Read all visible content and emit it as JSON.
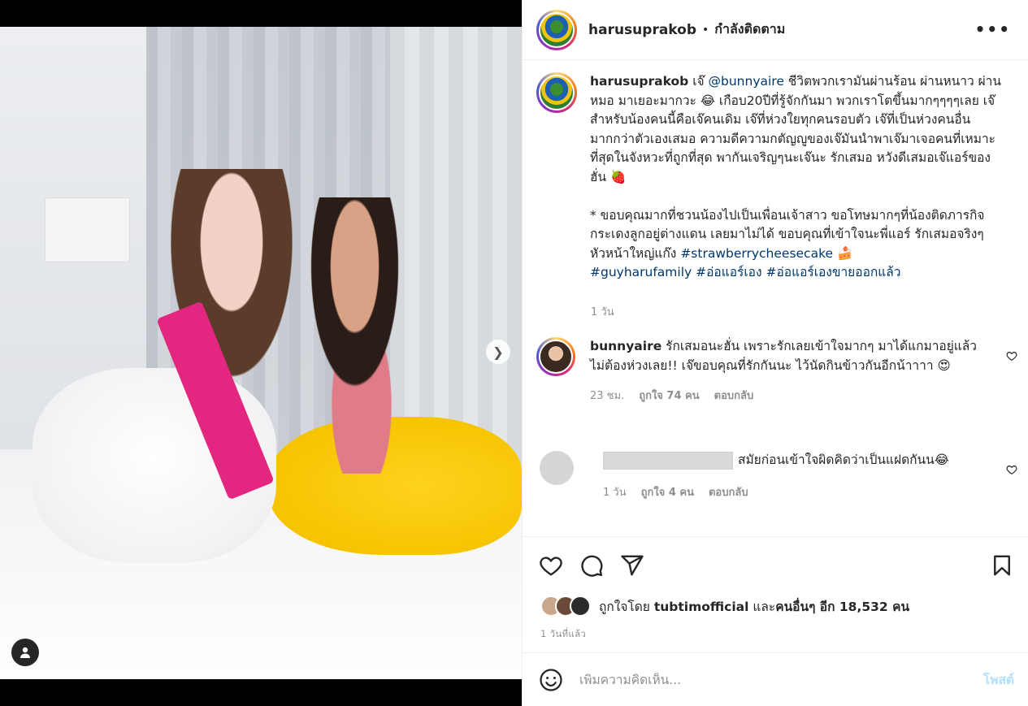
{
  "post": {
    "username": "harusuprakob",
    "separator": "•",
    "follow_status": "กำลังติดตาม",
    "more": "•••",
    "image_alt": "",
    "carousel_next": "❯"
  },
  "caption": {
    "username": "harusuprakob",
    "text_1": " เจ๊ ",
    "mention": "@bunnyaire",
    "text_2": " ชีวิตพวกเรามันผ่านร้อน ผ่านหนาว ผ่านหมอ มาเยอะมากวะ 😂 เกือบ20ปีที่รู้จักกันมา พวกเราโตขึ้นมากๆๆๆๆเลย เจ๊สำหรับน้องคนนี้คือเจ๊คนเดิม เจ๊ที่ห่วงใยทุกคนรอบตัว เจ๊ที่เป็นห่วงคนอื่นมากกว่าตัวเองเสมอ ความดีความกตัญญูของเจ๊มันนำพาเจ๊มาเจอคนที่เหมาะที่สุดในจังหวะที่ถูกที่สุด พากันเจริญๆนะเจ๊นะ รักเสมอ หวังดีเสมอเจ๊แอร์ของฮั่น 🍓",
    "text_3": "* ขอบคุณมากที่ชวนน้องไปเป็นเพื่อนเจ้าสาว ขอโทษมากๆที่น้องติดภารกิจกระเดงลูกอยู่ต่างแดน เลยมาไม่ได้ ขอบคุณที่เข้าใจนะพี่แอร์ รักเสมอจริงๆหัวหน้าใหญ่แก๊ง ",
    "hashtag_1": "#strawberrycheesecake",
    "emoji_cake": " 🍰",
    "hashtag_2": "#guyharufamily",
    "hashtag_3": "#อ่อแอร์เอง",
    "hashtag_4": "#อ่อแอร์เองขายออกแล้ว",
    "time": "1 วัน"
  },
  "comments": [
    {
      "username": "bunnyaire",
      "text": " รักเสมอนะฮั่น เพราะรักเลยเข้าใจมากๆ มาได้แกมาอยู่แล้ว ไม่ต้องห่วงเลย!! เจ๊ขอบคุณที่รักกันนะ ไว้นัดกินข้าวกันอีกน้าาาา 😍",
      "time": "23 ชม.",
      "likes": "ถูกใจ 74 คน",
      "reply": "ตอบกลับ"
    },
    {
      "username": "",
      "text": "สมัยก่อนเข้าใจผิดคิดว่าเป็นแฝดกันน😂",
      "time": "1 วัน",
      "likes": "ถูกใจ 4 คน",
      "reply": "ตอบกลับ"
    }
  ],
  "likes": {
    "prefix": "ถูกใจโดย ",
    "user": "tubtimofficial",
    "middle": " และ",
    "others": "คนอื่นๆ อีก 18,532 คน"
  },
  "post_time": "1 วันที่แล้ว",
  "add_comment": {
    "placeholder": "เพิ่มความคิดเห็น...",
    "post_label": "โพสต์"
  },
  "colors": {
    "link": "#00376b",
    "muted": "#8e8e8e",
    "post_disabled": "#b2dffc"
  }
}
